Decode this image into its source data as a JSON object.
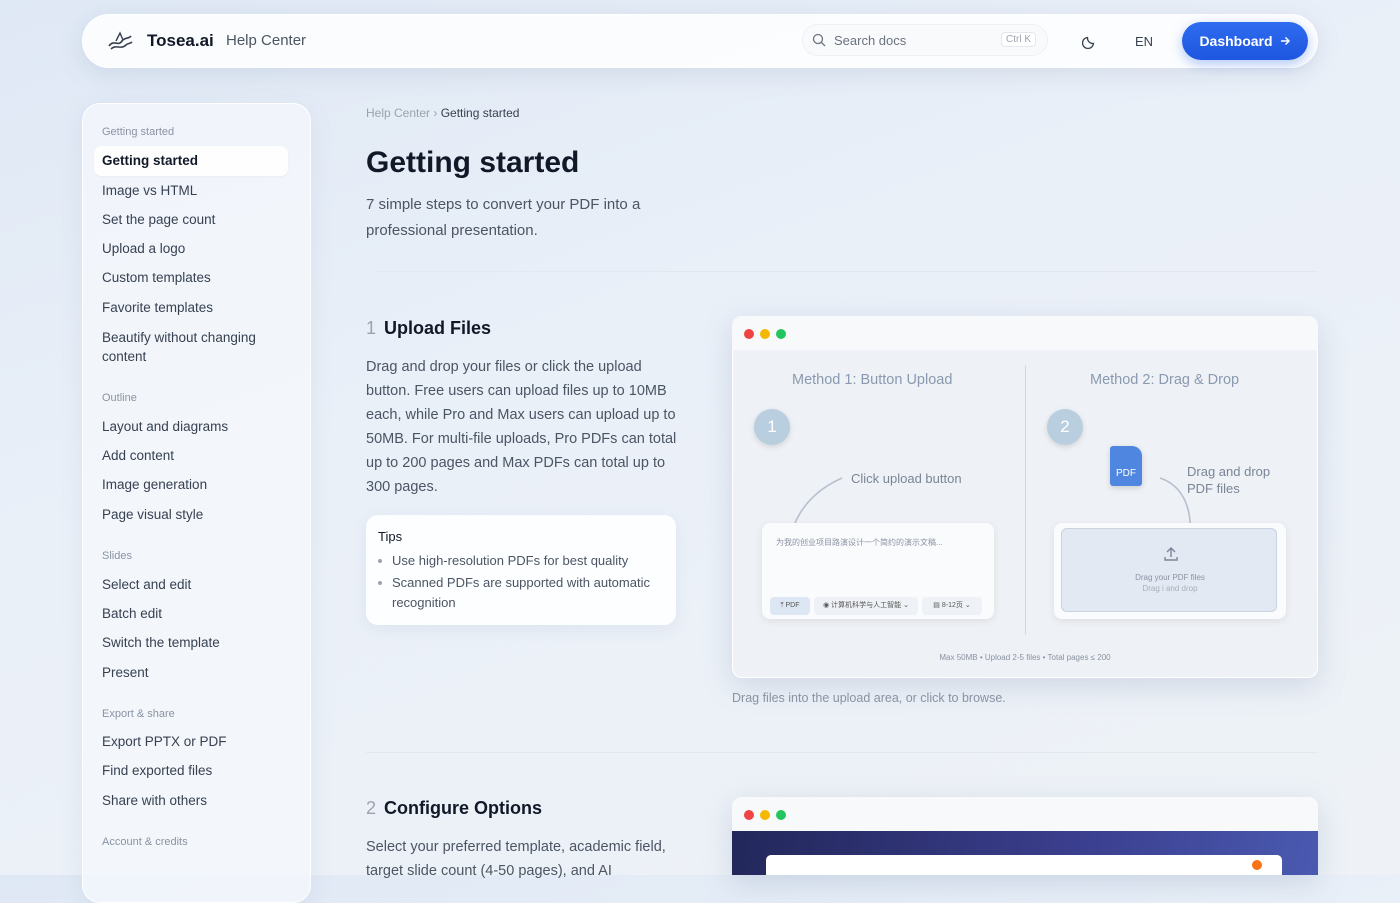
{
  "header": {
    "brand": "Tosea.ai",
    "brand_sub": "Help Center",
    "search_placeholder": "Search docs",
    "search_shortcut": "Ctrl K",
    "language": "EN",
    "dashboard_label": "Dashboard",
    "accent_color": "#2563eb"
  },
  "sidebar": {
    "groups": [
      {
        "heading": "Getting started",
        "items": [
          "Getting started",
          "Image vs HTML",
          "Set the page count",
          "Upload a logo",
          "Custom templates",
          "Favorite templates",
          "Beautify without changing content"
        ]
      },
      {
        "heading": "Outline",
        "items": [
          "Layout and diagrams",
          "Add content",
          "Image generation",
          "Page visual style"
        ]
      },
      {
        "heading": "Slides",
        "items": [
          "Select and edit",
          "Batch edit",
          "Switch the template",
          "Present"
        ]
      },
      {
        "heading": "Export & share",
        "items": [
          "Export PPTX or PDF",
          "Find exported files",
          "Share with others"
        ]
      },
      {
        "heading": "Account & credits",
        "items": []
      }
    ],
    "active_item": "Getting started"
  },
  "breadcrumb": {
    "root": "Help Center",
    "separator": "›",
    "current": "Getting started"
  },
  "page": {
    "title": "Getting started",
    "subtitle": "7 simple steps to convert your PDF into a professional presentation."
  },
  "steps": [
    {
      "number": "1",
      "title": "Upload Files",
      "body": "Drag and drop your files or click the upload button. Free users can upload files up to 10MB each, while Pro and Max users can upload up to 50MB. For multi-file uploads, Pro PDFs can total up to 200 pages and Max PDFs can total up to 300 pages.",
      "tips_title": "Tips",
      "tips": [
        "Use high-resolution PDFs for best quality",
        "Scanned PDFs are supported with automatic recognition"
      ],
      "illustration": {
        "method1_title": "Method 1: Button Upload",
        "method2_title": "Method 2: Drag & Drop",
        "badge1": "1",
        "badge2": "2",
        "click_note": "Click upload button",
        "drag_note": "Drag and drop PDF files",
        "pdf_icon_label": "PDF",
        "input_text": "为我的创业项目路演设计一个简约的演示文稿...",
        "chip_pdf": "PDF",
        "chip_field": "计算机科学与人工智能",
        "chip_pages": "8-12页",
        "dropzone_line1": "Drag your PDF files",
        "dropzone_line2": "Drag i and drop",
        "limits": "Max 50MB • Upload 2-5 files • Total pages ≤ 200"
      },
      "caption": "Drag files into the upload area, or click to browse."
    },
    {
      "number": "2",
      "title": "Configure Options",
      "body": "Select your preferred template, academic field, target slide count (4-50 pages), and AI"
    }
  ]
}
